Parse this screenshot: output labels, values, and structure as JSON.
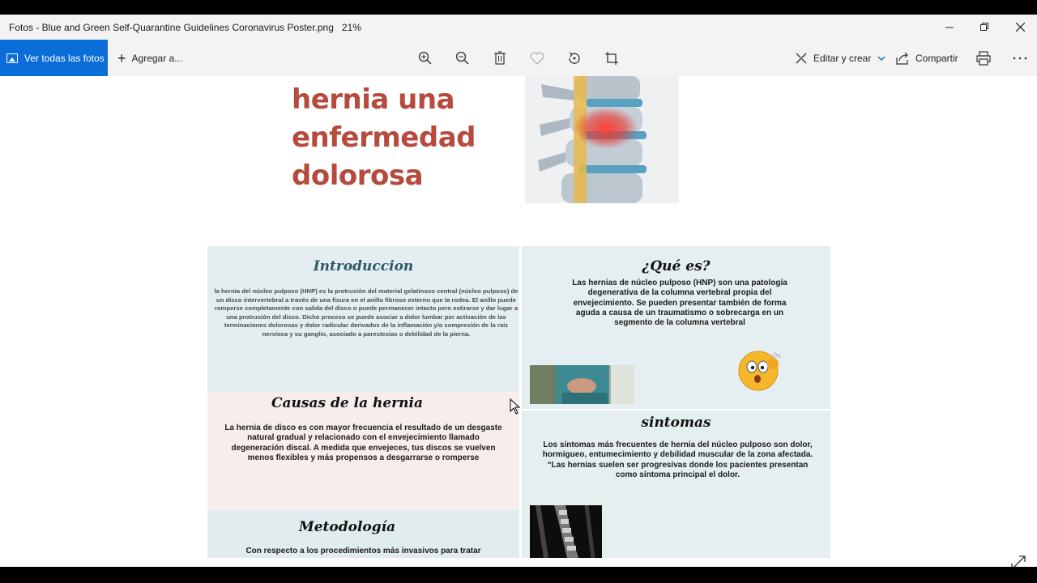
{
  "window": {
    "title": "Fotos - Blue and Green Self-Quarantine Guidelines Coronavirus Poster.png",
    "zoom": "21%"
  },
  "toolbar": {
    "all_photos_label": "Ver todas las fotos",
    "add_to_label": "Agregar a...",
    "edit_create_label": "Editar y crear",
    "share_label": "Compartir",
    "icons": [
      "zoom-in-icon",
      "zoom-out-icon",
      "delete-icon",
      "favorite-icon",
      "rotate-icon",
      "crop-icon",
      "print-icon",
      "more-icon"
    ]
  },
  "poster": {
    "title_line1": "hernia una",
    "title_line2": "enfermedad",
    "title_line3": "dolorosa",
    "colors": {
      "title": "#b64a3c",
      "intro_heading": "#2e5868",
      "accent_blue": "#0a6dd8"
    },
    "intro": {
      "heading": "Introduccion",
      "text": "la hernia del núcleo pulposo (HNP) es la protrusión del material gelatinoso central (núcleo pulposo) de un disco intervertebral a través de una fisura en el anillo fibroso externo que la rodea. El anillo puede romperse completamente con salida del disco o puede permanecer intacto pero estirarse y dar lugar a una protrusión del disco. Dicho proceso se puede asociar a dolor lumbar por activación de las terminaciones dolorosas y dolor radicular derivados de la inflamación y/o compresión de la raíz nerviosa y su ganglio, asociado a parestesias o debilidad de la pierna."
    },
    "que_es": {
      "heading": "¿Qué es?",
      "text": "Las hernias de núcleo pulposo (HNP) son una patología degenerativa de la columna vertebral propia del envejecimiento. Se pueden presentar también de forma aguda a causa de un traumatismo o sobrecarga en un segmento de la columna vertebral"
    },
    "causas": {
      "heading": "Causas de la hernia",
      "text": "La hernia de disco es con mayor frecuencia el resultado de un desgaste natural gradual y relacionado con el envejecimiento llamado degeneración discal. A medida que envejeces, tus discos se vuelven menos flexibles y más propensos a desgarrarse o romperse"
    },
    "sintomas": {
      "heading": "sintomas",
      "text": "Los síntomas más frecuentes de hernia del núcleo pulposo son dolor, hormigueo, entumecimiento y debilidad muscular de la zona afectada. “Las hernias suelen ser progresivas donde los pacientes presentan como síntoma principal el dolor."
    },
    "metodologia": {
      "heading": "Metodología",
      "text": "Con respecto a los procedimientos más invasivos para tratar"
    }
  }
}
